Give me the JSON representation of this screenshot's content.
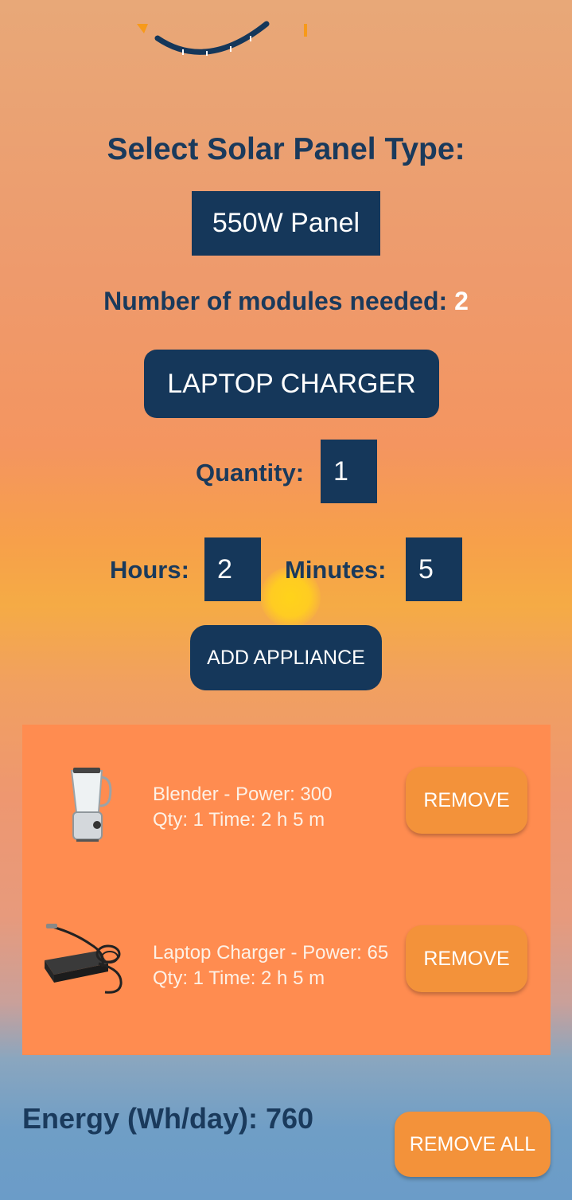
{
  "panel": {
    "title": "Select Solar Panel Type:",
    "selected": "550W Panel",
    "modules_label": "Number of modules needed: ",
    "modules_value": "2"
  },
  "appliance": {
    "selected": "LAPTOP CHARGER",
    "quantity_label": "Quantity:",
    "quantity_value": "1",
    "hours_label": "Hours:",
    "hours_value": "2",
    "minutes_label": "Minutes:",
    "minutes_value": "5",
    "add_label": "ADD APPLIANCE"
  },
  "list": {
    "items": [
      {
        "line1": "Blender - Power: 300",
        "line2": "Qty: 1 Time: 2 h 5 m",
        "remove_label": "REMOVE",
        "icon": "blender-icon"
      },
      {
        "line1": "Laptop Charger - Power: 65",
        "line2": "Qty: 1 Time: 2 h 5 m",
        "remove_label": "REMOVE",
        "icon": "laptop-charger-icon"
      }
    ]
  },
  "footer": {
    "energy_label": "Energy (Wh/day): 760",
    "remove_all_label": "REMOVE ALL"
  },
  "colors": {
    "primary": "#15375a",
    "accent": "#f3923a",
    "list_bg": "#ff8c50"
  }
}
